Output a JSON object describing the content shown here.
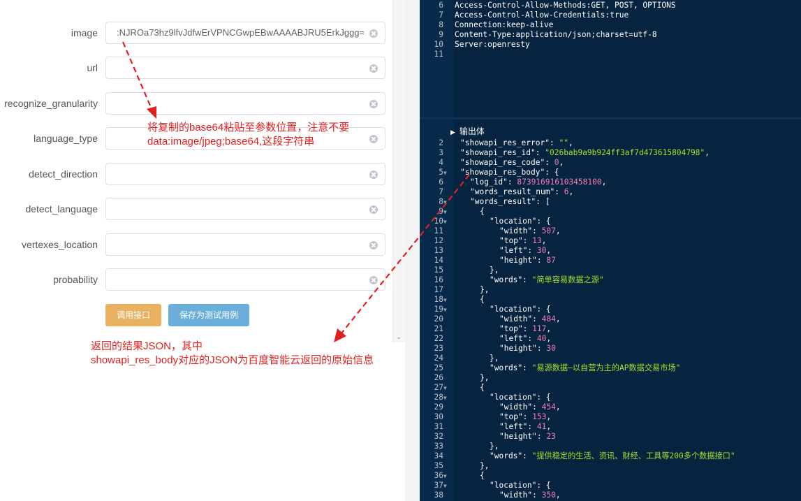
{
  "form": {
    "fields": [
      {
        "label": "image",
        "value": ":NJROa73hz9lfvJdfwErVPNCGwpEBwAAAABJRU5ErkJggg=="
      },
      {
        "label": "url",
        "value": ""
      },
      {
        "label": "recognize_granularity",
        "value": ""
      },
      {
        "label": "language_type",
        "value": ""
      },
      {
        "label": "detect_direction",
        "value": ""
      },
      {
        "label": "detect_language",
        "value": ""
      },
      {
        "label": "vertexes_location",
        "value": ""
      },
      {
        "label": "probability",
        "value": ""
      }
    ],
    "call_button": "调用接口",
    "save_button": "保存为测试用例"
  },
  "annotations": {
    "paste_tip": "将复制的base64粘贴至参数位置，注意不要data:image/jpeg;base64,这段字符串",
    "result_tip_line1": "返回的结果JSON，其中",
    "result_tip_line2": "showapi_res_body对应的JSON为百度智能云返回的原始信息"
  },
  "headers_pane": {
    "lines": [
      {
        "n": "6",
        "text": "Access-Control-Allow-Methods:GET, POST, OPTIONS"
      },
      {
        "n": "7",
        "text": "Access-Control-Allow-Credentials:true"
      },
      {
        "n": "8",
        "text": "Connection:keep-alive"
      },
      {
        "n": "9",
        "text": "Content-Type:application/json;charset=utf-8"
      },
      {
        "n": "10",
        "text": "Server:openresty"
      },
      {
        "n": "11",
        "text": ""
      }
    ]
  },
  "body_pane": {
    "title": "输出体",
    "lines": [
      {
        "n": "2",
        "indent": 1,
        "parts": [
          [
            "key",
            "\"showapi_res_error\": "
          ],
          [
            "str",
            "\"\""
          ],
          [
            "key",
            ","
          ]
        ]
      },
      {
        "n": "3",
        "indent": 1,
        "parts": [
          [
            "key",
            "\"showapi_res_id\": "
          ],
          [
            "str",
            "\"026bab9a9b924ff3af7d473615804798\""
          ],
          [
            "key",
            ","
          ]
        ]
      },
      {
        "n": "4",
        "indent": 1,
        "parts": [
          [
            "key",
            "\"showapi_res_code\": "
          ],
          [
            "num",
            "0"
          ],
          [
            "key",
            ","
          ]
        ]
      },
      {
        "n": "5",
        "indent": 1,
        "fold": true,
        "parts": [
          [
            "key",
            "\"showapi_res_body\": {"
          ]
        ]
      },
      {
        "n": "6",
        "indent": 2,
        "parts": [
          [
            "key",
            "\"log_id\": "
          ],
          [
            "num",
            "873916916103458100"
          ],
          [
            "key",
            ","
          ]
        ]
      },
      {
        "n": "7",
        "indent": 2,
        "parts": [
          [
            "key",
            "\"words_result_num\": "
          ],
          [
            "num",
            "6"
          ],
          [
            "key",
            ","
          ]
        ]
      },
      {
        "n": "8",
        "indent": 2,
        "fold": true,
        "parts": [
          [
            "key",
            "\"words_result\": ["
          ]
        ]
      },
      {
        "n": "9",
        "indent": 3,
        "fold": true,
        "parts": [
          [
            "key",
            "{"
          ]
        ]
      },
      {
        "n": "10",
        "indent": 4,
        "fold": true,
        "parts": [
          [
            "key",
            "\"location\": {"
          ]
        ]
      },
      {
        "n": "11",
        "indent": 5,
        "parts": [
          [
            "key",
            "\"width\": "
          ],
          [
            "num",
            "507"
          ],
          [
            "key",
            ","
          ]
        ]
      },
      {
        "n": "12",
        "indent": 5,
        "parts": [
          [
            "key",
            "\"top\": "
          ],
          [
            "num",
            "13"
          ],
          [
            "key",
            ","
          ]
        ]
      },
      {
        "n": "13",
        "indent": 5,
        "parts": [
          [
            "key",
            "\"left\": "
          ],
          [
            "num",
            "30"
          ],
          [
            "key",
            ","
          ]
        ]
      },
      {
        "n": "14",
        "indent": 5,
        "parts": [
          [
            "key",
            "\"height\": "
          ],
          [
            "num",
            "87"
          ]
        ]
      },
      {
        "n": "15",
        "indent": 4,
        "parts": [
          [
            "key",
            "},"
          ]
        ]
      },
      {
        "n": "16",
        "indent": 4,
        "parts": [
          [
            "key",
            "\"words\": "
          ],
          [
            "str",
            "\"简单容易数据之源\""
          ]
        ]
      },
      {
        "n": "17",
        "indent": 3,
        "parts": [
          [
            "key",
            "},"
          ]
        ]
      },
      {
        "n": "18",
        "indent": 3,
        "fold": true,
        "parts": [
          [
            "key",
            "{"
          ]
        ]
      },
      {
        "n": "19",
        "indent": 4,
        "fold": true,
        "parts": [
          [
            "key",
            "\"location\": {"
          ]
        ]
      },
      {
        "n": "20",
        "indent": 5,
        "parts": [
          [
            "key",
            "\"width\": "
          ],
          [
            "num",
            "484"
          ],
          [
            "key",
            ","
          ]
        ]
      },
      {
        "n": "21",
        "indent": 5,
        "parts": [
          [
            "key",
            "\"top\": "
          ],
          [
            "num",
            "117"
          ],
          [
            "key",
            ","
          ]
        ]
      },
      {
        "n": "22",
        "indent": 5,
        "parts": [
          [
            "key",
            "\"left\": "
          ],
          [
            "num",
            "40"
          ],
          [
            "key",
            ","
          ]
        ]
      },
      {
        "n": "23",
        "indent": 5,
        "parts": [
          [
            "key",
            "\"height\": "
          ],
          [
            "num",
            "30"
          ]
        ]
      },
      {
        "n": "24",
        "indent": 4,
        "parts": [
          [
            "key",
            "},"
          ]
        ]
      },
      {
        "n": "25",
        "indent": 4,
        "parts": [
          [
            "key",
            "\"words\": "
          ],
          [
            "str",
            "\"易源数据—以自营为主的AP数据交易市场\""
          ]
        ]
      },
      {
        "n": "26",
        "indent": 3,
        "parts": [
          [
            "key",
            "},"
          ]
        ]
      },
      {
        "n": "27",
        "indent": 3,
        "fold": true,
        "parts": [
          [
            "key",
            "{"
          ]
        ]
      },
      {
        "n": "28",
        "indent": 4,
        "fold": true,
        "parts": [
          [
            "key",
            "\"location\": {"
          ]
        ]
      },
      {
        "n": "29",
        "indent": 5,
        "parts": [
          [
            "key",
            "\"width\": "
          ],
          [
            "num",
            "454"
          ],
          [
            "key",
            ","
          ]
        ]
      },
      {
        "n": "30",
        "indent": 5,
        "parts": [
          [
            "key",
            "\"top\": "
          ],
          [
            "num",
            "153"
          ],
          [
            "key",
            ","
          ]
        ]
      },
      {
        "n": "31",
        "indent": 5,
        "parts": [
          [
            "key",
            "\"left\": "
          ],
          [
            "num",
            "41"
          ],
          [
            "key",
            ","
          ]
        ]
      },
      {
        "n": "32",
        "indent": 5,
        "parts": [
          [
            "key",
            "\"height\": "
          ],
          [
            "num",
            "23"
          ]
        ]
      },
      {
        "n": "33",
        "indent": 4,
        "parts": [
          [
            "key",
            "},"
          ]
        ]
      },
      {
        "n": "34",
        "indent": 4,
        "parts": [
          [
            "key",
            "\"words\": "
          ],
          [
            "str",
            "\"提供稳定的生活、资讯、财经、工具等200多个数据接口\""
          ]
        ]
      },
      {
        "n": "35",
        "indent": 3,
        "parts": [
          [
            "key",
            "},"
          ]
        ]
      },
      {
        "n": "36",
        "indent": 3,
        "fold": true,
        "parts": [
          [
            "key",
            "{"
          ]
        ]
      },
      {
        "n": "37",
        "indent": 4,
        "fold": true,
        "parts": [
          [
            "key",
            "\"location\": {"
          ]
        ]
      },
      {
        "n": "38",
        "indent": 5,
        "parts": [
          [
            "key",
            "\"width\": "
          ],
          [
            "num",
            "350"
          ],
          [
            "key",
            ","
          ]
        ]
      }
    ]
  },
  "colors": {
    "call_button": "#e8b261",
    "save_button": "#6aaedc",
    "annotation": "#e02020",
    "code_bg": "#062440",
    "string": "#a6e22e",
    "number": "#f080b8"
  }
}
